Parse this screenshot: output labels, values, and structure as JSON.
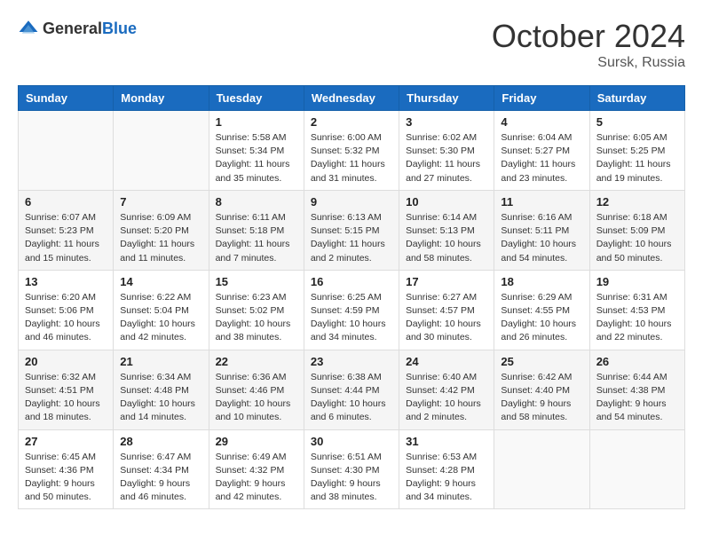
{
  "header": {
    "logo_general": "General",
    "logo_blue": "Blue",
    "month": "October 2024",
    "location": "Sursk, Russia"
  },
  "days_of_week": [
    "Sunday",
    "Monday",
    "Tuesday",
    "Wednesday",
    "Thursday",
    "Friday",
    "Saturday"
  ],
  "weeks": [
    [
      {
        "day": "",
        "info": ""
      },
      {
        "day": "",
        "info": ""
      },
      {
        "day": "1",
        "info": "Sunrise: 5:58 AM\nSunset: 5:34 PM\nDaylight: 11 hours and 35 minutes."
      },
      {
        "day": "2",
        "info": "Sunrise: 6:00 AM\nSunset: 5:32 PM\nDaylight: 11 hours and 31 minutes."
      },
      {
        "day": "3",
        "info": "Sunrise: 6:02 AM\nSunset: 5:30 PM\nDaylight: 11 hours and 27 minutes."
      },
      {
        "day": "4",
        "info": "Sunrise: 6:04 AM\nSunset: 5:27 PM\nDaylight: 11 hours and 23 minutes."
      },
      {
        "day": "5",
        "info": "Sunrise: 6:05 AM\nSunset: 5:25 PM\nDaylight: 11 hours and 19 minutes."
      }
    ],
    [
      {
        "day": "6",
        "info": "Sunrise: 6:07 AM\nSunset: 5:23 PM\nDaylight: 11 hours and 15 minutes."
      },
      {
        "day": "7",
        "info": "Sunrise: 6:09 AM\nSunset: 5:20 PM\nDaylight: 11 hours and 11 minutes."
      },
      {
        "day": "8",
        "info": "Sunrise: 6:11 AM\nSunset: 5:18 PM\nDaylight: 11 hours and 7 minutes."
      },
      {
        "day": "9",
        "info": "Sunrise: 6:13 AM\nSunset: 5:15 PM\nDaylight: 11 hours and 2 minutes."
      },
      {
        "day": "10",
        "info": "Sunrise: 6:14 AM\nSunset: 5:13 PM\nDaylight: 10 hours and 58 minutes."
      },
      {
        "day": "11",
        "info": "Sunrise: 6:16 AM\nSunset: 5:11 PM\nDaylight: 10 hours and 54 minutes."
      },
      {
        "day": "12",
        "info": "Sunrise: 6:18 AM\nSunset: 5:09 PM\nDaylight: 10 hours and 50 minutes."
      }
    ],
    [
      {
        "day": "13",
        "info": "Sunrise: 6:20 AM\nSunset: 5:06 PM\nDaylight: 10 hours and 46 minutes."
      },
      {
        "day": "14",
        "info": "Sunrise: 6:22 AM\nSunset: 5:04 PM\nDaylight: 10 hours and 42 minutes."
      },
      {
        "day": "15",
        "info": "Sunrise: 6:23 AM\nSunset: 5:02 PM\nDaylight: 10 hours and 38 minutes."
      },
      {
        "day": "16",
        "info": "Sunrise: 6:25 AM\nSunset: 4:59 PM\nDaylight: 10 hours and 34 minutes."
      },
      {
        "day": "17",
        "info": "Sunrise: 6:27 AM\nSunset: 4:57 PM\nDaylight: 10 hours and 30 minutes."
      },
      {
        "day": "18",
        "info": "Sunrise: 6:29 AM\nSunset: 4:55 PM\nDaylight: 10 hours and 26 minutes."
      },
      {
        "day": "19",
        "info": "Sunrise: 6:31 AM\nSunset: 4:53 PM\nDaylight: 10 hours and 22 minutes."
      }
    ],
    [
      {
        "day": "20",
        "info": "Sunrise: 6:32 AM\nSunset: 4:51 PM\nDaylight: 10 hours and 18 minutes."
      },
      {
        "day": "21",
        "info": "Sunrise: 6:34 AM\nSunset: 4:48 PM\nDaylight: 10 hours and 14 minutes."
      },
      {
        "day": "22",
        "info": "Sunrise: 6:36 AM\nSunset: 4:46 PM\nDaylight: 10 hours and 10 minutes."
      },
      {
        "day": "23",
        "info": "Sunrise: 6:38 AM\nSunset: 4:44 PM\nDaylight: 10 hours and 6 minutes."
      },
      {
        "day": "24",
        "info": "Sunrise: 6:40 AM\nSunset: 4:42 PM\nDaylight: 10 hours and 2 minutes."
      },
      {
        "day": "25",
        "info": "Sunrise: 6:42 AM\nSunset: 4:40 PM\nDaylight: 9 hours and 58 minutes."
      },
      {
        "day": "26",
        "info": "Sunrise: 6:44 AM\nSunset: 4:38 PM\nDaylight: 9 hours and 54 minutes."
      }
    ],
    [
      {
        "day": "27",
        "info": "Sunrise: 6:45 AM\nSunset: 4:36 PM\nDaylight: 9 hours and 50 minutes."
      },
      {
        "day": "28",
        "info": "Sunrise: 6:47 AM\nSunset: 4:34 PM\nDaylight: 9 hours and 46 minutes."
      },
      {
        "day": "29",
        "info": "Sunrise: 6:49 AM\nSunset: 4:32 PM\nDaylight: 9 hours and 42 minutes."
      },
      {
        "day": "30",
        "info": "Sunrise: 6:51 AM\nSunset: 4:30 PM\nDaylight: 9 hours and 38 minutes."
      },
      {
        "day": "31",
        "info": "Sunrise: 6:53 AM\nSunset: 4:28 PM\nDaylight: 9 hours and 34 minutes."
      },
      {
        "day": "",
        "info": ""
      },
      {
        "day": "",
        "info": ""
      }
    ]
  ]
}
